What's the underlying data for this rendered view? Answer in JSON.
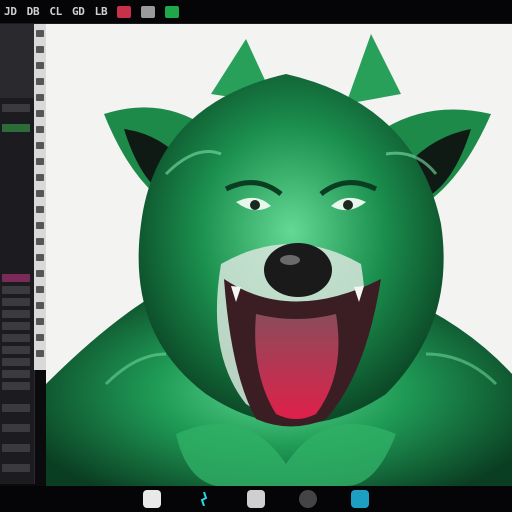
{
  "menubar": {
    "items": [
      "JD",
      "DB",
      "CL",
      "GD",
      "LB"
    ],
    "status_icons": [
      "red-icon",
      "gray-icon",
      "green-icon"
    ]
  },
  "canvas": {
    "artwork": "green-wolf-illustration",
    "background": "#f3f3f1",
    "fur_colors": [
      "#0f6b3a",
      "#1f9a55",
      "#5cd68e",
      "#0a3d22"
    ]
  },
  "dock": {
    "icons": [
      "document-icon",
      "spark-icon",
      "viewer-icon",
      "camera-icon",
      "globe-icon"
    ]
  }
}
